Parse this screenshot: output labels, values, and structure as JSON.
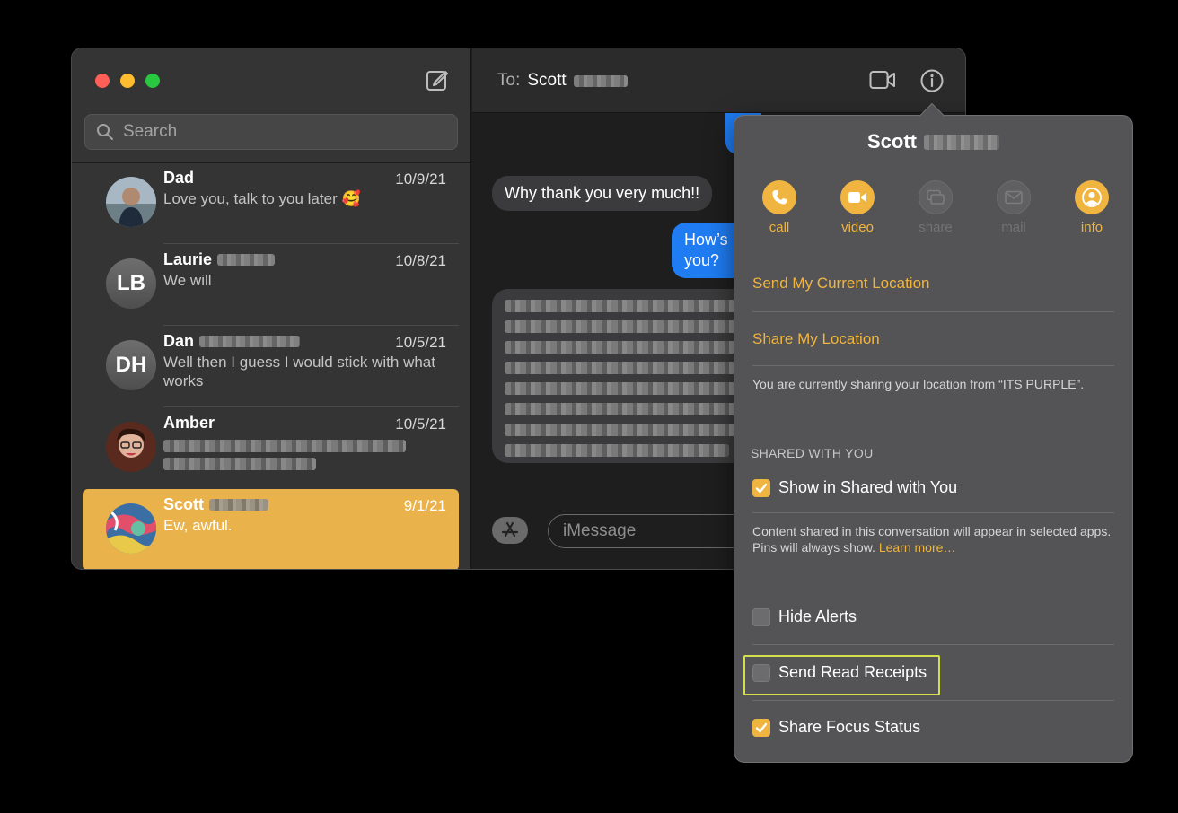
{
  "sidebar": {
    "search_placeholder": "Search",
    "conversations": [
      {
        "name": "Dad",
        "date": "10/9/21",
        "preview": "Love you, talk to you later 🥰"
      },
      {
        "name": "Laurie",
        "initials": "LB",
        "date": "10/8/21",
        "preview": "We will"
      },
      {
        "name": "Dan",
        "initials": "DH",
        "date": "10/5/21",
        "preview": "Well then I guess I would stick with what works"
      },
      {
        "name": "Amber",
        "date": "10/5/21",
        "preview": ""
      },
      {
        "name": "Scott",
        "date": "9/1/21",
        "preview": "Ew, awful."
      }
    ]
  },
  "chat": {
    "to_label": "To:",
    "recipient": "Scott",
    "messages": [
      {
        "text": "Why thank you very much!!"
      },
      {
        "text": "How’s you?"
      }
    ],
    "composer_placeholder": "iMessage"
  },
  "popover": {
    "title": "Scott",
    "actions": [
      {
        "label": "call",
        "icon": "phone-icon",
        "enabled": true
      },
      {
        "label": "video",
        "icon": "video-camera-icon",
        "enabled": true
      },
      {
        "label": "share",
        "icon": "share-screen-icon",
        "enabled": false
      },
      {
        "label": "mail",
        "icon": "mail-icon",
        "enabled": false
      },
      {
        "label": "info",
        "icon": "person-icon",
        "enabled": true
      }
    ],
    "send_location": "Send My Current Location",
    "share_location": "Share My Location",
    "location_note": "You are currently sharing your location from “ITS PURPLE”.",
    "shared_section": "SHARED WITH YOU",
    "show_shared": "Show in Shared with You",
    "shared_note": "Content shared in this conversation will appear in selected apps. Pins will always show.",
    "learn_more": "Learn more…",
    "hide_alerts": "Hide Alerts",
    "read_receipts": "Send Read Receipts",
    "focus_status": "Share Focus Status"
  },
  "colors": {
    "accent": "#f0b541",
    "selected_row": "#e9b24a",
    "outgoing_bubble": "#1f7cf3",
    "highlight_box": "#d3e04b"
  }
}
